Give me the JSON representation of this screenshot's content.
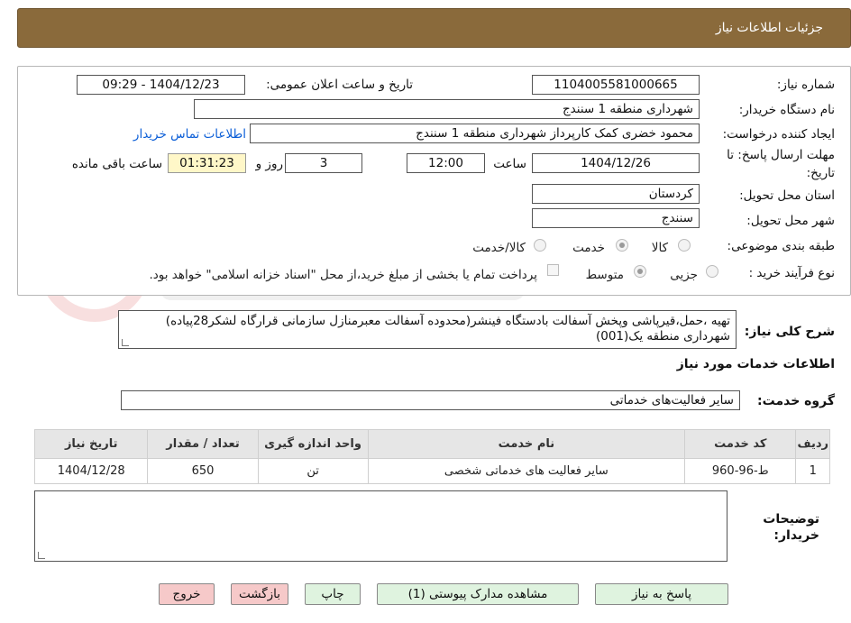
{
  "header": {
    "title": "جزئیات اطلاعات نیاز"
  },
  "form": {
    "need_number_label": "شماره نیاز:",
    "need_number": "1104005581000665",
    "announce_label": "تاریخ و ساعت اعلان عمومی:",
    "announce_value": "1404/12/23 - 09:29",
    "buyer_org_label": "نام دستگاه خریدار:",
    "buyer_org": "شهرداری منطقه 1 سنندج",
    "creator_label": "ایجاد کننده درخواست:",
    "creator": "محمود خضری کمک کارپرداز شهرداری منطقه 1 سنندج",
    "contact_link": "اطلاعات تماس خریدار",
    "deadline_label_1": "مهلت ارسال پاسخ: تا",
    "deadline_label_2": "تاریخ:",
    "deadline_date": "1404/12/26",
    "time_label": "ساعت",
    "deadline_time": "12:00",
    "days_value": "3",
    "days_label": "روز و",
    "remaining": "01:31:23",
    "remaining_label": "ساعت باقی مانده",
    "province_label": "استان محل تحویل:",
    "province": "کردستان",
    "city_label": "شهر محل تحویل:",
    "city": "سنندج",
    "category_label": "طبقه بندی موضوعی:",
    "category_options": [
      "کالا",
      "خدمت",
      "کالا/خدمت"
    ],
    "process_label": "نوع فرآیند خرید :",
    "process_options": [
      "جزیی",
      "متوسط"
    ],
    "payment_note": "پرداخت تمام یا بخشی از مبلغ خرید،از محل \"اسناد خزانه اسلامی\" خواهد بود."
  },
  "summary": {
    "label": "شرح کلی نیاز:",
    "text": "تهیه ،حمل،قیرپاشی وپخش آسفالت بادستگاه فینشر(محدوده آسفالت معبرمنازل سازمانی قرارگاه لشکر28پیاده) شهرداری منطقه یک(001)"
  },
  "services": {
    "section_title": "اطلاعات خدمات مورد نیاز",
    "group_label": "گروه خدمت:",
    "group_value": "سایر فعالیت‌های خدماتی",
    "columns": [
      "ردیف",
      "کد خدمت",
      "نام خدمت",
      "واحد اندازه گیری",
      "تعداد / مقدار",
      "تاریخ نیاز"
    ],
    "rows": [
      [
        "1",
        "ط-96-960",
        "سایر فعالیت های خدماتی شخصی",
        "تن",
        "650",
        "1404/12/28"
      ]
    ]
  },
  "buyer_notes": {
    "label_1": "توضیحات",
    "label_2": "خریدار:"
  },
  "buttons": {
    "reply": "پاسخ به نیاز",
    "attachments": "مشاهده مدارک پیوستی (1)",
    "print": "چاپ",
    "back": "بازگشت",
    "exit": "خروج"
  },
  "colors": {
    "header_bg": "#8a6a3b",
    "timer_bg": "#fff7c8",
    "link": "#0b5ed7",
    "green_button": "#dff3df",
    "pink_button": "#f6c9c9"
  }
}
